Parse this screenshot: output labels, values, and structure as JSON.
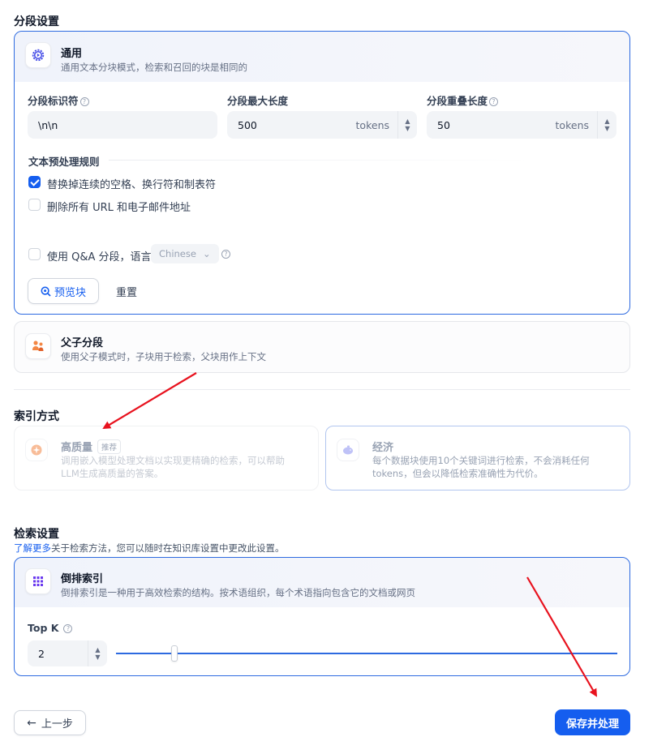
{
  "segment": {
    "title": "分段设置",
    "general": {
      "title": "通用",
      "desc": "通用文本分块模式，检索和召回的块是相同的",
      "delimiter_label": "分段标识符",
      "delimiter_value": "\\n\\n",
      "max_length_label": "分段最大长度",
      "max_length_value": "500",
      "max_length_unit": "tokens",
      "overlap_label": "分段重叠长度",
      "overlap_value": "50",
      "overlap_unit": "tokens",
      "rules_title": "文本预处理规则",
      "rule1": "替换掉连续的空格、换行符和制表符",
      "rule1_checked": true,
      "rule2": "删除所有 URL 和电子邮件地址",
      "rule2_checked": false,
      "qa_label": "使用 Q&A 分段，语言",
      "qa_language": "Chinese",
      "preview_btn": "预览块",
      "reset_btn": "重置"
    },
    "parent_child": {
      "title": "父子分段",
      "desc": "使用父子模式时，子块用于检索，父块用作上下文"
    }
  },
  "index": {
    "title": "索引方式",
    "high_quality": {
      "title": "高质量",
      "tag": "推荐",
      "desc1": "调用嵌入模型处理文档以实现更精确的检索，可以帮助",
      "desc2": "LLM生成高质量的答案。"
    },
    "economy": {
      "title": "经济",
      "desc1": "每个数据块使用10个关键词进行检索，不会消耗任何",
      "desc2": "tokens，但会以降低检索准确性为代价。"
    }
  },
  "retrieval": {
    "title": "检索设置",
    "learn_more": "了解更多",
    "desc": "关于检索方法，您可以随时在知识库设置中更改此设置。",
    "inverted": {
      "title": "倒排索引",
      "desc": "倒排索引是一种用于高效检索的结构。按术语组织，每个术语指向包含它的文档或网页"
    },
    "topk_label": "Top K",
    "topk_value": "2"
  },
  "footer": {
    "back_btn": "上一步",
    "save_btn": "保存并处理"
  },
  "colors": {
    "accent": "#155eef",
    "annotation_arrow": "#e8121e"
  }
}
